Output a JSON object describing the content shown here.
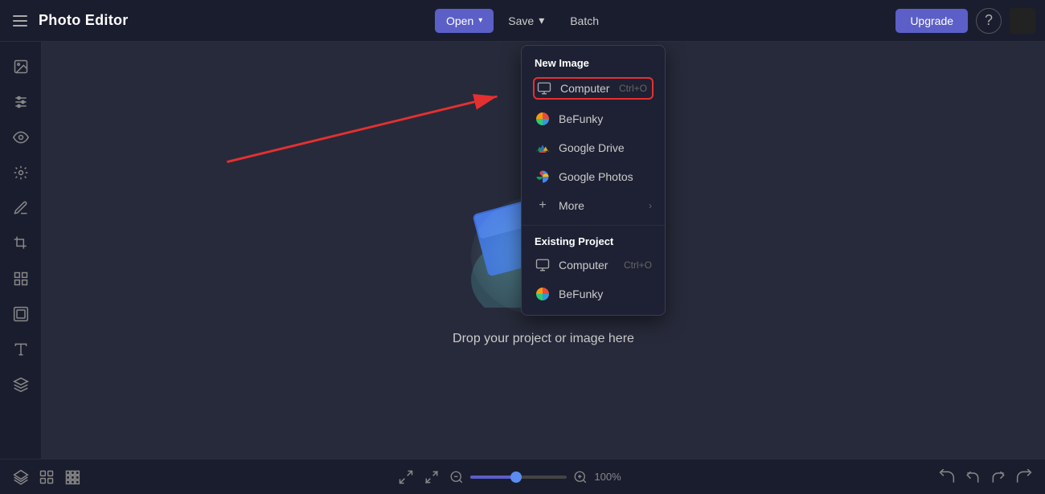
{
  "app": {
    "title": "Photo Editor"
  },
  "header": {
    "open_label": "Open",
    "open_chevron": "▾",
    "save_label": "Save",
    "save_chevron": "▾",
    "batch_label": "Batch",
    "upgrade_label": "Upgrade",
    "help_label": "?"
  },
  "dropdown": {
    "new_image_section": "New Image",
    "existing_project_section": "Existing Project",
    "items_new": [
      {
        "id": "computer-new",
        "label": "Computer",
        "shortcut": "Ctrl+O",
        "highlighted": true
      },
      {
        "id": "befunky-new",
        "label": "BeFunky",
        "shortcut": ""
      },
      {
        "id": "gdrive-new",
        "label": "Google Drive",
        "shortcut": ""
      },
      {
        "id": "gphotos-new",
        "label": "Google Photos",
        "shortcut": ""
      },
      {
        "id": "more-new",
        "label": "More",
        "shortcut": "",
        "has_arrow": true
      }
    ],
    "items_existing": [
      {
        "id": "computer-existing",
        "label": "Computer",
        "shortcut": "Ctrl+O"
      },
      {
        "id": "befunky-existing",
        "label": "BeFunky",
        "shortcut": ""
      }
    ]
  },
  "canvas": {
    "drop_text": "Drop your project or image here"
  },
  "bottom_toolbar": {
    "zoom_value": "100%"
  },
  "sidebar": {
    "icons": [
      {
        "id": "image",
        "symbol": "🖼"
      },
      {
        "id": "adjustments",
        "symbol": "⚡"
      },
      {
        "id": "eye",
        "symbol": "👁"
      },
      {
        "id": "effects",
        "symbol": "✨"
      },
      {
        "id": "brush",
        "symbol": "🖌"
      },
      {
        "id": "crop",
        "symbol": "⬜"
      },
      {
        "id": "elements",
        "symbol": "❋"
      },
      {
        "id": "frames",
        "symbol": "▦"
      },
      {
        "id": "text",
        "symbol": "T"
      },
      {
        "id": "graphics",
        "symbol": "🎨"
      }
    ]
  }
}
